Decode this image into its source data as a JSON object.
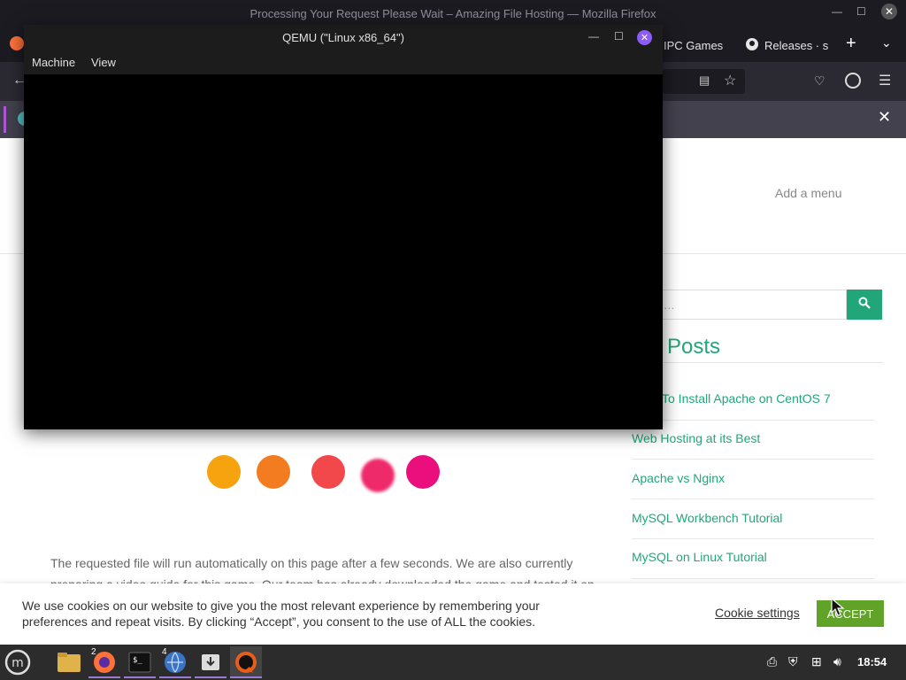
{
  "firefox": {
    "window_title": "Processing Your Request Please Wait – Amazing File Hosting — Mozilla Firefox",
    "tabs": [
      {
        "label": "IPC Games"
      },
      {
        "label": "Releases · s"
      }
    ]
  },
  "qemu": {
    "title": "QEMU (\"Linux x86_64\")",
    "menu": [
      "Machine",
      "View"
    ]
  },
  "page": {
    "header_menu": "Add a menu",
    "search_placeholder": "h …",
    "recent_posts_title": "ent Posts",
    "recent_posts": [
      "To Install Apache on CentOS 7",
      "Web Hosting at its Best",
      "Apache vs Nginx",
      "MySQL Workbench Tutorial",
      "MySQL on Linux Tutorial"
    ],
    "loader_colors": [
      "#f7a20f",
      "#f47c20",
      "#f2484b",
      "#ee2a6b",
      "#ea0f7d"
    ],
    "body_text_1": "The requested file will run automatically on this page after a few seconds. We are also currently",
    "body_text_2": "preparing a video guide for this game. Our team has already downloaded the game and tested it on"
  },
  "cookie": {
    "text": "We use cookies on our website to give you the most relevant experience by remembering your preferences and repeat visits. By clicking “Accept”, you consent to the use of ALL the cookies.",
    "settings_label": "Cookie settings",
    "accept_label": "ACCEPT"
  },
  "taskbar": {
    "badges": {
      "firefox": "2",
      "browser": "4"
    },
    "clock": "18:54"
  }
}
